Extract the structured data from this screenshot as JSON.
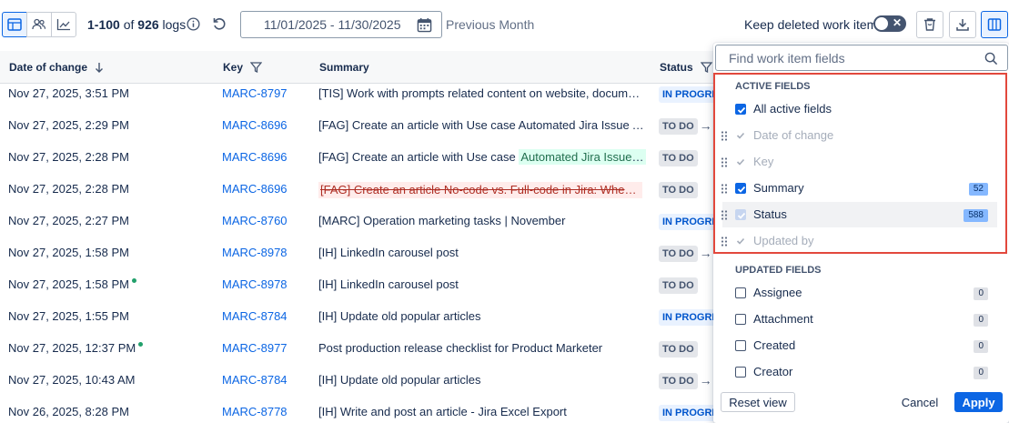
{
  "toolbar": {
    "range_label": "1-100",
    "of_label": " of ",
    "total": "926",
    "unit": " logs",
    "date_range": "11/01/2025 - 11/30/2025",
    "preset": "Previous Month",
    "keep_deleted": "Keep deleted work items",
    "toggle_state": "off"
  },
  "table": {
    "columns": [
      "Date of change",
      "Key",
      "Summary",
      "Status"
    ],
    "rows": [
      {
        "date": "Nov 27, 2025, 3:51 PM",
        "dot": false,
        "key": "MARC-8797",
        "summary": "[TIS] Work with prompts related content on website, document…",
        "sum_style": "plain",
        "status": "IN PROGRESS",
        "arrow": false
      },
      {
        "date": "Nov 27, 2025, 2:29 PM",
        "dot": false,
        "key": "MARC-8696",
        "summary": "[FAG] Create an article with Use case Automated Jira Issue As…",
        "sum_style": "plain",
        "status": "TO DO",
        "arrow": true
      },
      {
        "date": "Nov 27, 2025, 2:28 PM",
        "dot": false,
        "key": "MARC-8696",
        "summary": "[FAG] Create an article with Use case ",
        "summary_added": "Automated Jira Issue As…",
        "sum_style": "added",
        "status": "TO DO",
        "arrow": false
      },
      {
        "date": "Nov 27, 2025, 2:28 PM",
        "dot": false,
        "key": "MARC-8696",
        "summary": "[FAG] Create an article No-code vs. Full-code in Jira: When Eac…",
        "sum_style": "deleted",
        "status": "TO DO",
        "arrow": false
      },
      {
        "date": "Nov 27, 2025, 2:27 PM",
        "dot": false,
        "key": "MARC-8760",
        "summary": "[MARC] Operation marketing tasks | November",
        "sum_style": "plain",
        "status": "IN PROGRESS",
        "arrow": false
      },
      {
        "date": "Nov 27, 2025, 1:58 PM",
        "dot": false,
        "key": "MARC-8978",
        "summary": "[IH] LinkedIn carousel post",
        "sum_style": "plain",
        "status": "TO DO",
        "arrow": true
      },
      {
        "date": "Nov 27, 2025, 1:58 PM",
        "dot": true,
        "key": "MARC-8978",
        "summary": "[IH] LinkedIn carousel post",
        "sum_style": "plain",
        "status": "TO DO",
        "arrow": false
      },
      {
        "date": "Nov 27, 2025, 1:55 PM",
        "dot": false,
        "key": "MARC-8784",
        "summary": "[IH] Update old popular articles",
        "sum_style": "plain",
        "status": "IN PROGRESS",
        "arrow": false
      },
      {
        "date": "Nov 27, 2025, 12:37 PM",
        "dot": true,
        "key": "MARC-8977",
        "summary": "Post production release checklist for Product Marketer",
        "sum_style": "plain",
        "status": "TO DO",
        "arrow": false
      },
      {
        "date": "Nov 27, 2025, 10:43 AM",
        "dot": false,
        "key": "MARC-8784",
        "summary": "[IH] Update old popular articles",
        "sum_style": "plain",
        "status": "TO DO",
        "arrow": true
      },
      {
        "date": "Nov 26, 2025, 8:28 PM",
        "dot": false,
        "key": "MARC-8778",
        "summary": "[IH] Write and post an article - Jira Excel Export",
        "sum_style": "plain",
        "status": "IN PROGRESS",
        "arrow": false
      }
    ]
  },
  "panel": {
    "search_placeholder": "Find work item fields",
    "active_title": "ACTIVE FIELDS",
    "all_active": "All active fields",
    "active_fields": [
      {
        "label": "Date of change",
        "state": "disabled",
        "badge": ""
      },
      {
        "label": "Key",
        "state": "disabled",
        "badge": ""
      },
      {
        "label": "Summary",
        "state": "checked",
        "badge": "52"
      },
      {
        "label": "Status",
        "state": "checked-light",
        "badge": "588"
      },
      {
        "label": "Updated by",
        "state": "disabled",
        "badge": ""
      }
    ],
    "updated_title": "UPDATED FIELDS",
    "updated_fields": [
      {
        "label": "Assignee",
        "badge": "0"
      },
      {
        "label": "Attachment",
        "badge": "0"
      },
      {
        "label": "Created",
        "badge": "0"
      },
      {
        "label": "Creator",
        "badge": "0"
      }
    ],
    "reset": "Reset view",
    "cancel": "Cancel",
    "apply": "Apply"
  },
  "colors": {
    "accent": "#0c66e4",
    "highlight_border": "#e2483d"
  }
}
